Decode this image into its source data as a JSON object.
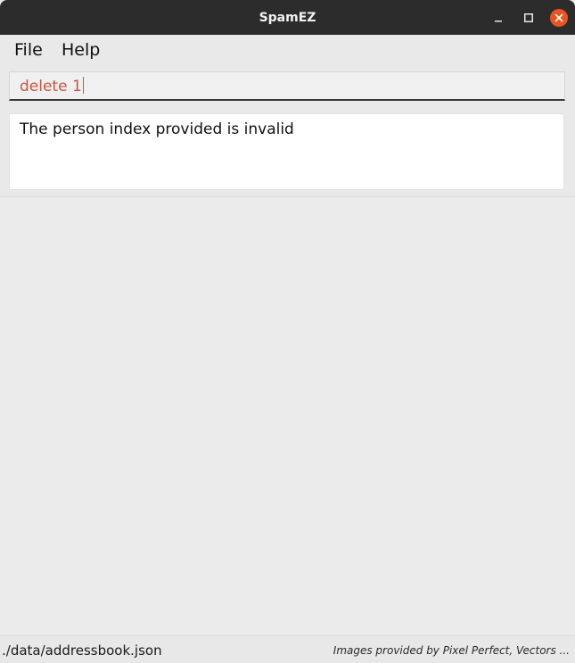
{
  "window": {
    "title": "SpamEZ",
    "controls": [
      "minimize-icon",
      "maximize-icon",
      "close-icon"
    ],
    "close_color": "#e95420"
  },
  "menu": {
    "items": [
      {
        "label": "File"
      },
      {
        "label": "Help"
      }
    ]
  },
  "command": {
    "value": "delete 1",
    "text_color": "#c8553d"
  },
  "result": {
    "message": "The person index provided is invalid"
  },
  "status": {
    "file_path": "./data/addressbook.json",
    "credit": "Images provided by Pixel Perfect, Vectors ..."
  }
}
